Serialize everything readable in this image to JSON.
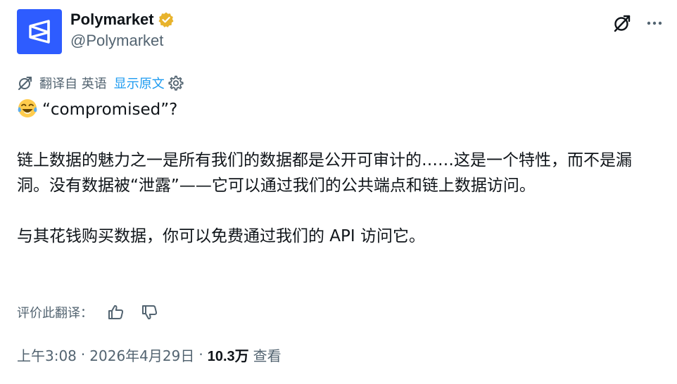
{
  "colors": {
    "text": "#0f1419",
    "secondary": "#536471",
    "link": "#1d9bf0",
    "brand": "#2e5cff",
    "verified": "#e8b32c"
  },
  "author": {
    "display_name": "Polymarket",
    "handle": "@Polymarket",
    "avatar_icon": "polymarket-logo",
    "verified_icon": "verified-badge-icon"
  },
  "header_actions": {
    "grok_icon": "grok-icon",
    "more_icon": "more-icon"
  },
  "translation": {
    "icon": "translate-icon",
    "label": "翻译自 英语",
    "show_original": "显示原文",
    "settings_icon": "gear-icon"
  },
  "tweet": {
    "emoji": "face-with-tears-of-joy",
    "line1": "“compromised”?",
    "para2": "链上数据的魅力之一是所有我们的数据都是公开可审计的……这是一个特性，而不是漏洞。没有数据被“泄露”——它可以通过我们的公共端点和链上数据访问。",
    "para3": "与其花钱购买数据，你可以免费通过我们的 API 访问它。"
  },
  "rating": {
    "label": "评价此翻译：",
    "thumbs_up_icon": "thumbs-up-icon",
    "thumbs_down_icon": "thumbs-down-icon"
  },
  "meta": {
    "time": "上午3:08",
    "separator": "·",
    "date": "2026年4月29日",
    "views_count": "10.3万",
    "views_label": "查看"
  }
}
